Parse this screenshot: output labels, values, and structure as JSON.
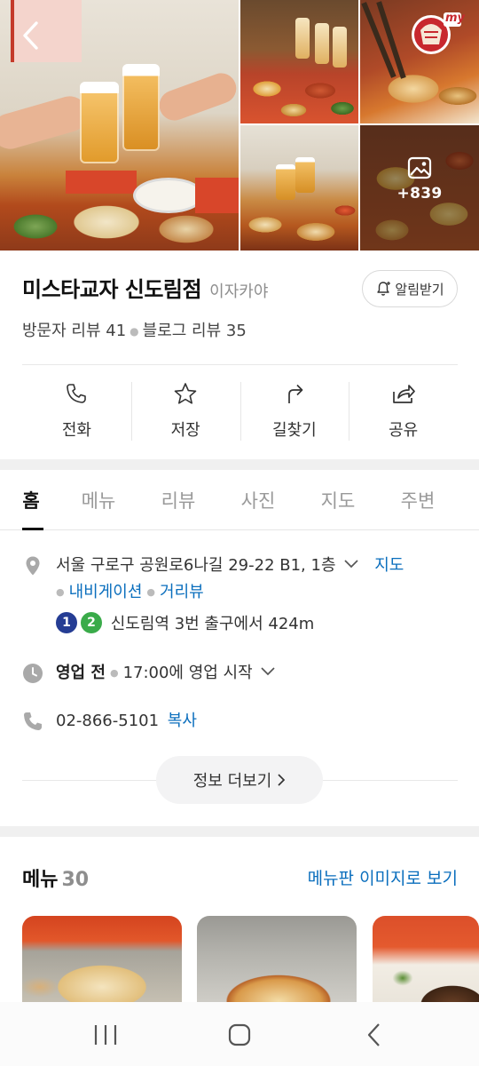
{
  "photos": {
    "more_count": "+839"
  },
  "header_badge": {
    "text": "my"
  },
  "place": {
    "name": "미스타교자 신도림점",
    "category": "이자카야",
    "alert_label": "알림받기",
    "visitor_reviews": "방문자 리뷰 41",
    "blog_reviews": "블로그 리뷰 35"
  },
  "actions": [
    {
      "label": "전화",
      "icon": "phone-icon"
    },
    {
      "label": "저장",
      "icon": "star-icon"
    },
    {
      "label": "길찾기",
      "icon": "directions-icon"
    },
    {
      "label": "공유",
      "icon": "share-icon"
    }
  ],
  "tabs": [
    "홈",
    "메뉴",
    "리뷰",
    "사진",
    "지도",
    "주변"
  ],
  "active_tab": "홈",
  "info": {
    "address": "서울 구로구 공원로6나길 29-22 B1, 1층",
    "map_link": "지도",
    "navigation_link": "내비게이션",
    "street_view_link": "거리뷰",
    "station_lines": [
      "1",
      "2"
    ],
    "station_text": "신도림역 3번 출구에서 424m",
    "hours_status": "영업 전",
    "hours_detail": "17:00에 영업 시작",
    "phone": "02-866-5101",
    "copy_label": "복사",
    "more_label": "정보 더보기"
  },
  "menu": {
    "title": "메뉴",
    "count": "30",
    "menu_board_link": "메뉴판 이미지로 보기"
  },
  "colors": {
    "link": "#0a6ebd",
    "line1": "#253d94",
    "line2": "#3aab4a",
    "badge_red": "#c8282e"
  }
}
